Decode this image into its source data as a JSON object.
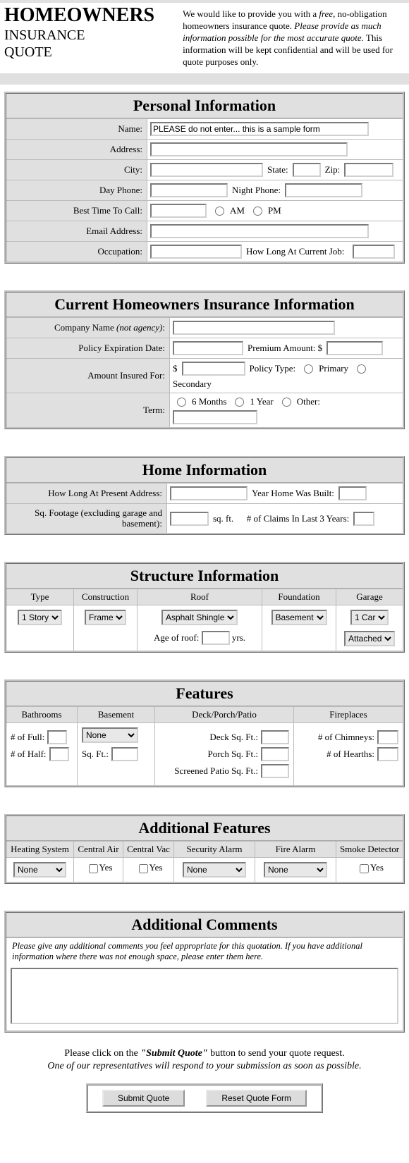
{
  "header": {
    "title1": "HOMEOWNERS",
    "title2": "INSURANCE",
    "title3": "QUOTE",
    "intro_a": "We would like to provide you with a ",
    "intro_free": "free",
    "intro_b": ", no-obligation homeowners insurance quote. ",
    "intro_please": "Please provide as much information possible for the most accurate quote.",
    "intro_c": " This information will be kept confidential and will be used for quote purposes only."
  },
  "personal": {
    "heading": "Personal Information",
    "name_label": "Name:",
    "name_value": "PLEASE do not enter... this is a sample form",
    "address_label": "Address:",
    "city_label": "City:",
    "state_label": "State:",
    "zip_label": "Zip:",
    "dayphone_label": "Day Phone:",
    "nightphone_label": "Night Phone:",
    "besttime_label": "Best Time To Call:",
    "am_label": "AM",
    "pm_label": "PM",
    "email_label": "Email Address:",
    "occupation_label": "Occupation:",
    "howlongjob_label": "How Long At Current Job:"
  },
  "current": {
    "heading": "Current Homeowners Insurance Information",
    "company_label": "Company Name ",
    "company_note": "(not agency)",
    "company_colon": ":",
    "expdate_label": "Policy Expiration Date:",
    "premium_label": "Premium Amount: $",
    "amountinsured_label": "Amount Insured For:",
    "dollar": "$",
    "policytype_label": "Policy Type:",
    "primary_label": "Primary",
    "secondary_label": "Secondary",
    "term_label": "Term:",
    "term_6m": "6 Months",
    "term_1y": "1 Year",
    "term_other": "Other:"
  },
  "home": {
    "heading": "Home Information",
    "howlong_label": "How Long At Present Address:",
    "yearbuilt_label": "Year Home Was Built:",
    "sqft_label": "Sq. Footage (excluding garage and basement):",
    "sqft_unit": "sq. ft.",
    "claims_label": "# of Claims In Last 3 Years:"
  },
  "structure": {
    "heading": "Structure Information",
    "type_head": "Type",
    "construction_head": "Construction",
    "roof_head": "Roof",
    "foundation_head": "Foundation",
    "garage_head": "Garage",
    "type_value": "1 Story",
    "construction_value": "Frame",
    "roof_value": "Asphalt Shingle",
    "ageofroof_label": "Age of roof:",
    "yrs_label": "yrs.",
    "foundation_value": "Basement",
    "garage_value": "1 Car",
    "garage_attached": "Attached"
  },
  "features": {
    "heading": "Features",
    "bathrooms_head": "Bathrooms",
    "basement_head": "Basement",
    "deck_head": "Deck/Porch/Patio",
    "fireplaces_head": "Fireplaces",
    "full_label": "# of Full:",
    "half_label": "# of Half:",
    "basement_value": "None",
    "basement_sqft_label": "Sq. Ft.:",
    "decksqft_label": "Deck Sq. Ft.:",
    "porchsqft_label": "Porch Sq. Ft.:",
    "screenedsqft_label": "Screened Patio Sq. Ft.:",
    "chimneys_label": "# of Chimneys:",
    "hearths_label": "# of Hearths:"
  },
  "additional": {
    "heading": "Additional Features",
    "heating_head": "Heating System",
    "centralair_head": "Central Air",
    "centralvac_head": "Central Vac",
    "security_head": "Security Alarm",
    "firealarm_head": "Fire Alarm",
    "smoke_head": "Smoke Detector",
    "none_value": "None",
    "yes_label": "Yes"
  },
  "comments": {
    "heading": "Additional Comments",
    "instruction": "Please give any additional comments you feel appropriate for this quotation. If you have additional information where there was not enough space, please enter them here."
  },
  "footer": {
    "line1a": "Please click on the ",
    "line1b": "\"Submit Quote\"",
    "line1c": " button to send your quote request.",
    "line2": "One of our representatives will respond to your submission as soon as possible.",
    "submit_label": "Submit Quote",
    "reset_label": "Reset Quote Form"
  }
}
